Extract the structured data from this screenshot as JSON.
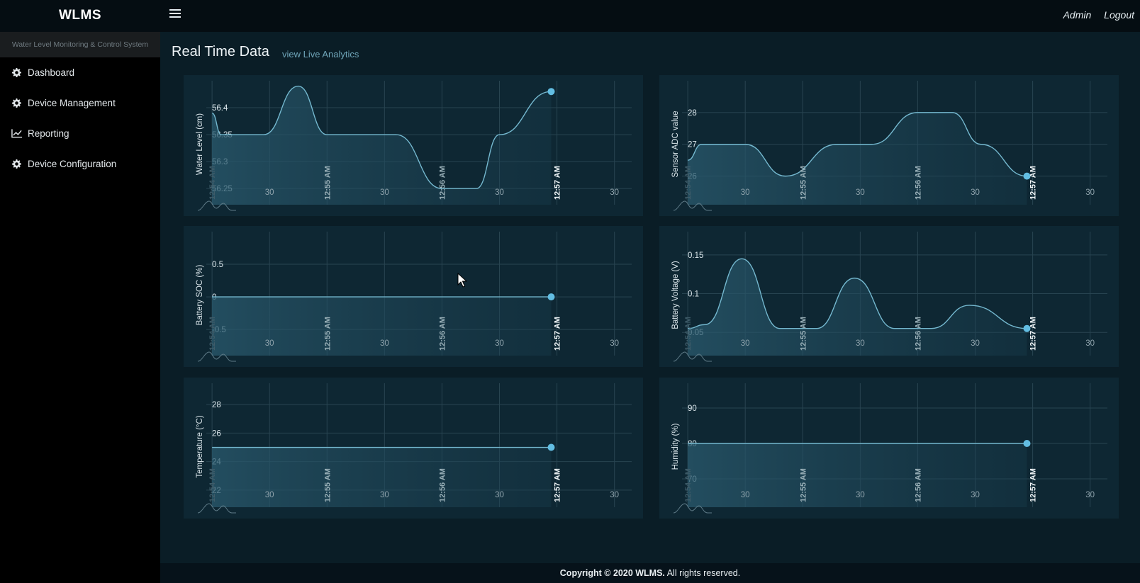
{
  "app": {
    "brand": "WLMS",
    "subtitle": "Water Level Monitoring & Control System",
    "user": "Admin",
    "logout": "Logout"
  },
  "sidebar": {
    "items": [
      {
        "label": "Dashboard",
        "icon": "gear-icon"
      },
      {
        "label": "Device Management",
        "icon": "gear-icon"
      },
      {
        "label": "Reporting",
        "icon": "line-chart-icon"
      },
      {
        "label": "Device Configuration",
        "icon": "gear-icon"
      }
    ]
  },
  "page": {
    "title": "Real Time Data",
    "link": "view Live Analytics"
  },
  "footer": {
    "copyright": "Copyright © 2020 WLMS.",
    "rights": "All rights reserved."
  },
  "colors": {
    "series": "#74b8cf",
    "dot": "#62bde2",
    "panel": "#0e2733",
    "background": "#0a1d26"
  },
  "chart_data": [
    {
      "type": "area",
      "ylabel": "Water Level (cm)",
      "ylim": [
        56.22,
        56.45
      ],
      "yticks": [
        "56.25",
        "56.3",
        "56.35",
        "56.4"
      ],
      "xticks": [
        "12:54 AM",
        "30",
        "12:55 AM",
        "30",
        "12:56 AM",
        "30",
        "12:57 AM",
        "30"
      ],
      "x_minutes": [
        0.0,
        0.08,
        0.45,
        0.75,
        1.0,
        1.12,
        1.45,
        1.6,
        2.0,
        2.1,
        2.3,
        2.5,
        2.95
      ],
      "values": [
        56.39,
        56.35,
        56.35,
        56.44,
        56.35,
        56.35,
        56.35,
        56.35,
        56.25,
        56.25,
        56.25,
        56.35,
        56.43
      ]
    },
    {
      "type": "area",
      "ylabel": "Sensor ADC value",
      "ylim": [
        25.1,
        29.0
      ],
      "yticks": [
        "26",
        "27",
        "28"
      ],
      "xticks": [
        "12:54 AM",
        "30",
        "12:55 AM",
        "30",
        "12:56 AM",
        "30",
        "12:57 AM",
        "30"
      ],
      "x_minutes": [
        0.0,
        0.12,
        0.5,
        0.85,
        1.3,
        1.6,
        2.0,
        2.3,
        2.55,
        2.95
      ],
      "values": [
        26.5,
        27,
        27,
        26,
        27,
        27,
        28,
        28,
        27,
        26
      ]
    },
    {
      "type": "area",
      "ylabel": "Battery SOC (%)",
      "ylim": [
        -0.9,
        1.0
      ],
      "yticks": [
        "-0.5",
        "0",
        "0.5"
      ],
      "xticks": [
        "12:54 AM",
        "30",
        "12:55 AM",
        "30",
        "12:56 AM",
        "30",
        "12:57 AM",
        "30"
      ],
      "x_minutes": [
        0.0,
        2.95
      ],
      "values": [
        0,
        0
      ]
    },
    {
      "type": "area",
      "ylabel": "Battery Voltage (V)",
      "ylim": [
        0.02,
        0.18
      ],
      "yticks": [
        "0.05",
        "0.1",
        "0.15"
      ],
      "xticks": [
        "12:54 AM",
        "30",
        "12:55 AM",
        "30",
        "12:56 AM",
        "30",
        "12:57 AM",
        "30"
      ],
      "x_minutes": [
        0.0,
        0.15,
        0.47,
        0.8,
        1.12,
        1.45,
        1.8,
        2.12,
        2.45,
        2.95
      ],
      "values": [
        0.055,
        0.06,
        0.145,
        0.055,
        0.055,
        0.12,
        0.055,
        0.055,
        0.085,
        0.055
      ]
    },
    {
      "type": "area",
      "ylabel": "Temperature (°C)",
      "ylim": [
        20.8,
        29.5
      ],
      "yticks": [
        "22",
        "24",
        "26",
        "28"
      ],
      "xticks": [
        "12:54 AM",
        "30",
        "12:55 AM",
        "30",
        "12:56 AM",
        "30",
        "12:57 AM",
        "30"
      ],
      "x_minutes": [
        0.0,
        2.95
      ],
      "values": [
        25,
        25
      ]
    },
    {
      "type": "area",
      "ylabel": "Humidity (%)",
      "ylim": [
        62,
        97
      ],
      "yticks": [
        "70",
        "80",
        "90"
      ],
      "xticks": [
        "12:54 AM",
        "30",
        "12:55 AM",
        "30",
        "12:56 AM",
        "30",
        "12:57 AM",
        "30"
      ],
      "x_minutes": [
        0.0,
        2.95
      ],
      "values": [
        80,
        80
      ]
    }
  ]
}
